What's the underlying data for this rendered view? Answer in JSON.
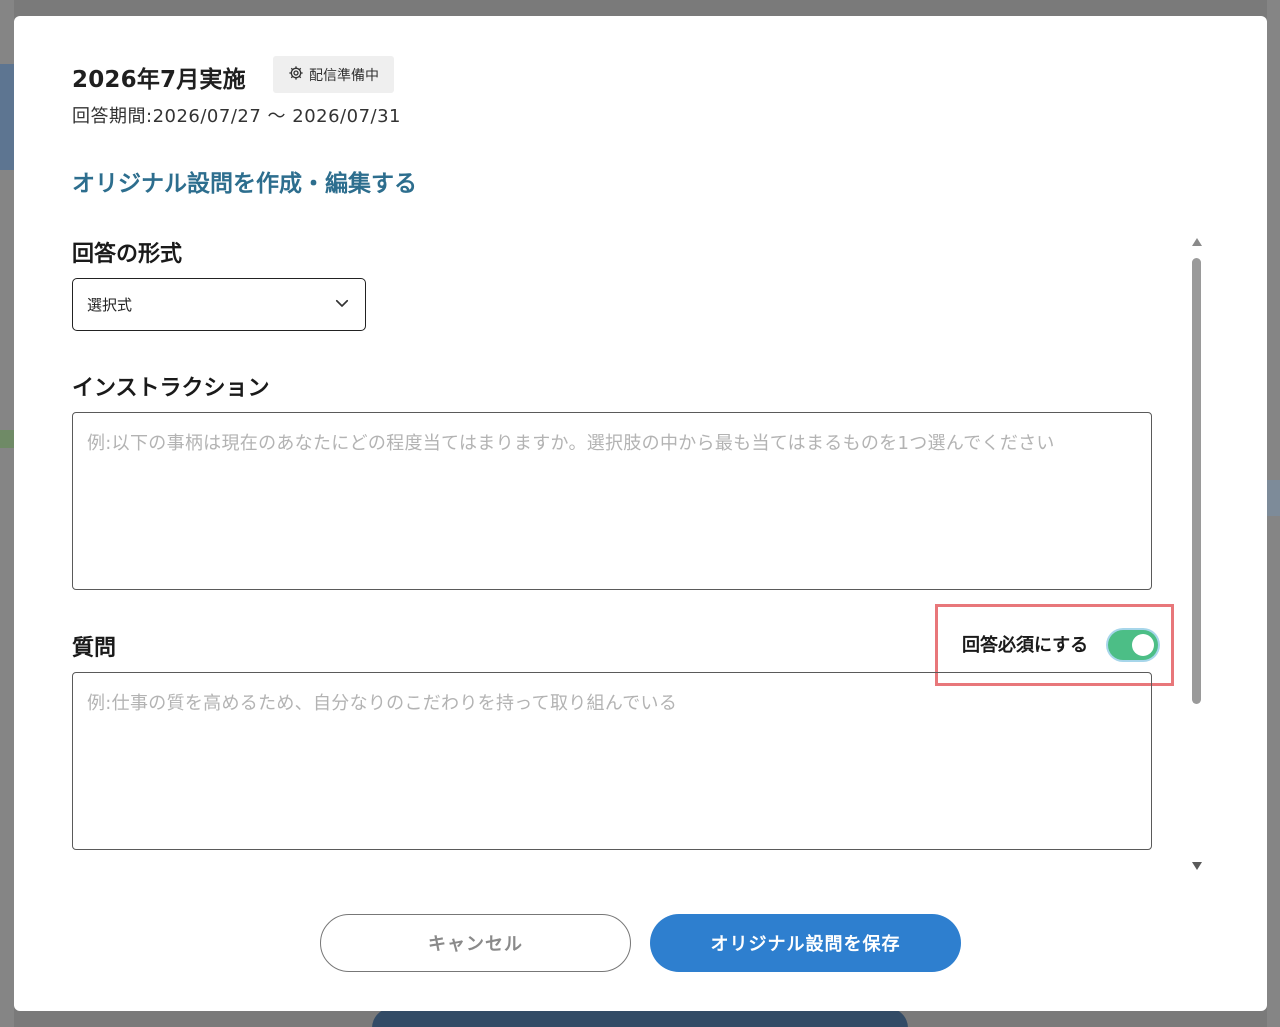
{
  "header": {
    "title": "2026年7月実施",
    "status_badge": "配信準備中",
    "period": "回答期間:2026/07/27 〜 2026/07/31"
  },
  "section_title": "オリジナル設問を作成・編集する",
  "form": {
    "answer_format_label": "回答の形式",
    "answer_format_value": "選択式",
    "instruction_label": "インストラクション",
    "instruction_placeholder": "例:以下の事柄は現在のあなたにどの程度当てはまりますか。選択肢の中から最も当てはまるものを1つ選んでください",
    "question_label": "質問",
    "required_toggle_label": "回答必須にする",
    "required_toggle_on": true,
    "question_placeholder": "例:仕事の質を高めるため、自分なりのこだわりを持って取り組んでいる"
  },
  "buttons": {
    "cancel": "キャンセル",
    "save": "オリジナル設問を保存"
  },
  "colors": {
    "link": "#2d6e8e",
    "primary_button": "#2e7fcf",
    "toggle_on": "#4cbe86",
    "highlight_border": "#e8777a"
  },
  "icons": {
    "status": "gear-icon",
    "select": "chevron-down-icon"
  }
}
